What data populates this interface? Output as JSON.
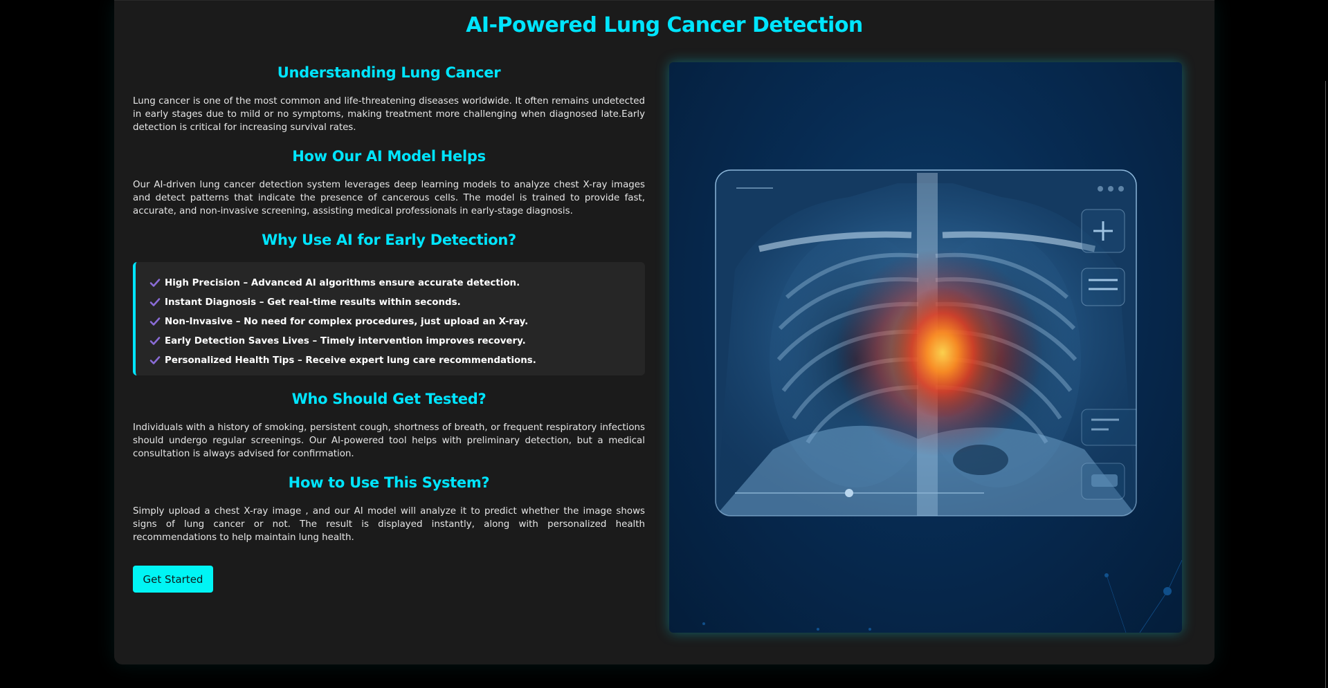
{
  "page": {
    "title": "AI-Powered Lung Cancer Detection"
  },
  "sections": {
    "understanding": {
      "heading": "Understanding Lung Cancer",
      "text": "Lung cancer is one of the most common and life-threatening diseases worldwide. It often remains undetected in early stages due to mild or no symptoms, making treatment more challenging when diagnosed late.Early detection is critical for increasing survival rates."
    },
    "helps": {
      "heading": "How Our AI Model Helps",
      "text": "Our AI-driven lung cancer detection system leverages deep learning models to analyze chest X-ray images and detect patterns that indicate the presence of cancerous cells. The model is trained to provide fast, accurate, and non-invasive screening, assisting medical professionals in early-stage diagnosis."
    },
    "why": {
      "heading": "Why Use AI for Early Detection?",
      "items": [
        "High Precision – Advanced AI algorithms ensure accurate detection.",
        "Instant Diagnosis – Get real-time results within seconds.",
        "Non-Invasive – No need for complex procedures, just upload an X-ray.",
        "Early Detection Saves Lives – Timely intervention improves recovery.",
        "Personalized Health Tips – Receive expert lung care recommendations."
      ]
    },
    "who": {
      "heading": "Who Should Get Tested?",
      "text": "Individuals with a history of smoking, persistent cough, shortness of breath, or frequent respiratory infections should undergo regular screenings. Our AI-powered tool helps with preliminary detection, but a medical consultation is always advised for confirmation."
    },
    "how": {
      "heading": "How to Use This System?",
      "text": "Simply upload a chest X-ray image , and our AI model will analyze it to predict whether the image shows signs of lung cancer or not. The result is displayed instantly, along with personalized health recommendations to help maintain lung health."
    }
  },
  "actions": {
    "get_started_label": "Get Started"
  },
  "colors": {
    "accent": "#00e5ff",
    "check": "#8a6cd6",
    "button": "#00f5f5",
    "card_bg": "#1b1b1b",
    "benefits_bg": "#262626"
  },
  "icons": {
    "check": "check-icon",
    "zoom_in": "plus-icon",
    "menu": "menu-icon"
  }
}
